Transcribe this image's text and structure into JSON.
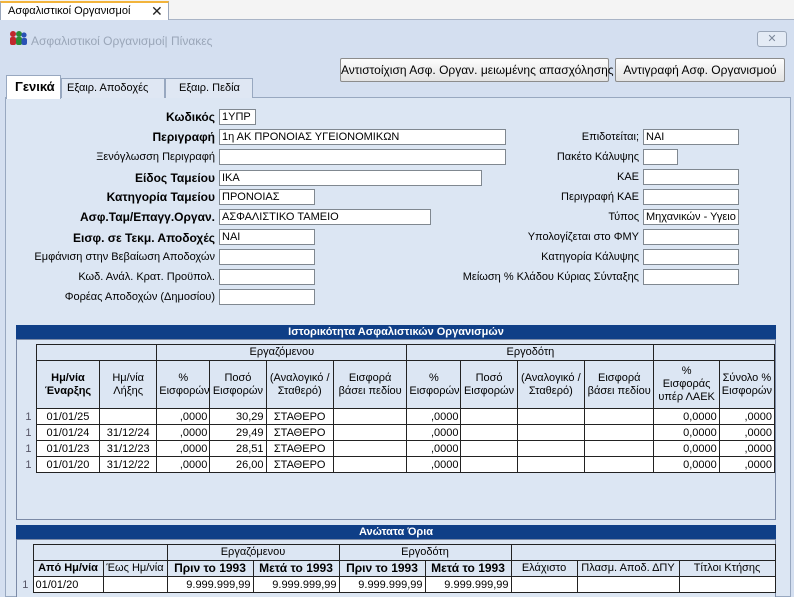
{
  "doc_tab": {
    "label": "Ασφαλιστικοί Οργανισμοί",
    "close": "✕"
  },
  "window": {
    "title": "Ασφαλιστικοί Οργανισμοί| Πίνακες",
    "close": "✕"
  },
  "toolbar": {
    "map_button": "Αντιστοίχιση Ασφ. Οργαν. μειωμένης απασχόλησης",
    "copy_button": "Αντιγραφή Ασφ. Οργανισμού"
  },
  "tabs": [
    "Γενικά",
    "Εξαιρ. Αποδοχές",
    "Εξαιρ. Πεδία"
  ],
  "form_left": [
    {
      "label": "Κωδικός",
      "value": "1ΥΠΡ"
    },
    {
      "label": "Περιγραφή",
      "value": "1η ΑΚ ΠΡΟΝΟΙΑΣ ΥΓΕΙΟΝΟΜΙΚΩΝ"
    },
    {
      "label": "Ξενόγλωσση Περιγραφή",
      "value": ""
    },
    {
      "label": "Είδος Ταμείου",
      "value": "ΙΚΑ"
    },
    {
      "label": "Κατηγορία Ταμείου",
      "value": "ΠΡΟΝΟΙΑΣ"
    },
    {
      "label": "Ασφ.Ταμ/Επαγγ.Οργαν.",
      "value": "ΑΣΦΑΛΙΣΤΙΚΟ ΤΑΜΕΙΟ"
    },
    {
      "label": "Εισφ. σε Τεκμ. Αποδοχές",
      "value": "ΝΑΙ"
    },
    {
      "label": "Εμφάνιση στην Βεβαίωση Αποδοχών",
      "value": ""
    },
    {
      "label": "Κωδ. Ανάλ. Κρατ. Προϋπολ.",
      "value": ""
    },
    {
      "label": "Φορέας Αποδοχών (Δημοσίου)",
      "value": ""
    }
  ],
  "form_right": [
    {
      "label": "Επιδοτείται;",
      "value": "ΝΑΙ"
    },
    {
      "label": "Πακέτο Κάλυψης",
      "value": ""
    },
    {
      "label": "ΚΑΕ",
      "value": ""
    },
    {
      "label": "Περιγραφή ΚΑΕ",
      "value": ""
    },
    {
      "label": "Τύπος",
      "value": "Μηχανικών - Υγειο"
    },
    {
      "label": "Υπολογίζεται στο ΦΜΥ",
      "value": ""
    },
    {
      "label": "Κατηγορία Κάλυψης",
      "value": ""
    },
    {
      "label": "Μείωση % Κλάδου Κύριας Σύνταξης",
      "value": ""
    }
  ],
  "history": {
    "title": "Ιστορικότητα Ασφαλιστικών Οργανισμών",
    "group_employee": "Εργαζόμενου",
    "group_employer": "Εργοδότη",
    "columns": {
      "start": "Ημ/νία Έναρξης",
      "end": "Ημ/νία Λήξης",
      "emp_pct": "% Εισφορών",
      "emp_amount": "Ποσό Εισφορών",
      "emp_type": "(Αναλογικό / Σταθερό)",
      "emp_field": "Εισφορά βάσει πεδίου",
      "er_pct": "% Εισφορών",
      "er_amount": "Ποσό Εισφορών",
      "er_type": "(Αναλογικό / Σταθερό)",
      "er_field": "Εισφορά βάσει πεδίου",
      "over_laek": "% Εισφοράς υπέρ ΛΑΕΚ",
      "total_pct": "Σύνολο % Εισφορών"
    },
    "rows": [
      {
        "start": "01/01/25",
        "end": "",
        "emp_pct": ",0000",
        "emp_amount": "30,29",
        "emp_type": "ΣΤΑΘΕΡΟ",
        "emp_field": "",
        "er_pct": ",0000",
        "er_amount": "",
        "er_type": "",
        "er_field": "",
        "over_laek": "0,0000",
        "total_pct": ",0000"
      },
      {
        "start": "01/01/24",
        "end": "31/12/24",
        "emp_pct": ",0000",
        "emp_amount": "29,49",
        "emp_type": "ΣΤΑΘΕΡΟ",
        "emp_field": "",
        "er_pct": ",0000",
        "er_amount": "",
        "er_type": "",
        "er_field": "",
        "over_laek": "0,0000",
        "total_pct": ",0000"
      },
      {
        "start": "01/01/23",
        "end": "31/12/23",
        "emp_pct": ",0000",
        "emp_amount": "28,51",
        "emp_type": "ΣΤΑΘΕΡΟ",
        "emp_field": "",
        "er_pct": ",0000",
        "er_amount": "",
        "er_type": "",
        "er_field": "",
        "over_laek": "0,0000",
        "total_pct": ",0000"
      },
      {
        "start": "01/01/20",
        "end": "31/12/22",
        "emp_pct": ",0000",
        "emp_amount": "26,00",
        "emp_type": "ΣΤΑΘΕΡΟ",
        "emp_field": "",
        "er_pct": ",0000",
        "er_amount": "",
        "er_type": "",
        "er_field": "",
        "over_laek": "0,0000",
        "total_pct": ",0000"
      }
    ]
  },
  "limits": {
    "title": "Ανώτατα Όρια",
    "group_employee": "Εργαζόμενου",
    "group_employer": "Εργοδότη",
    "columns": {
      "from": "Από Ημ/νία",
      "to": "Έως Ημ/νία",
      "emp_before": "Πριν το 1993",
      "emp_after": "Μετά το 1993",
      "er_before": "Πριν το 1993",
      "er_after": "Μετά το 1993",
      "minimum": "Ελάχιστο",
      "notional": "Πλασμ. Αποδ. ΔΠΥ",
      "title_ktisis": "Τίτλοι Κτήσης"
    },
    "rows": [
      {
        "from": "01/01/20",
        "to": "",
        "emp_before": "9.999.999,99",
        "emp_after": "9.999.999,99",
        "er_before": "9.999.999,99",
        "er_after": "9.999.999,99",
        "minimum": "",
        "notional": "",
        "title_ktisis": ""
      }
    ]
  },
  "row_indicator": "1"
}
